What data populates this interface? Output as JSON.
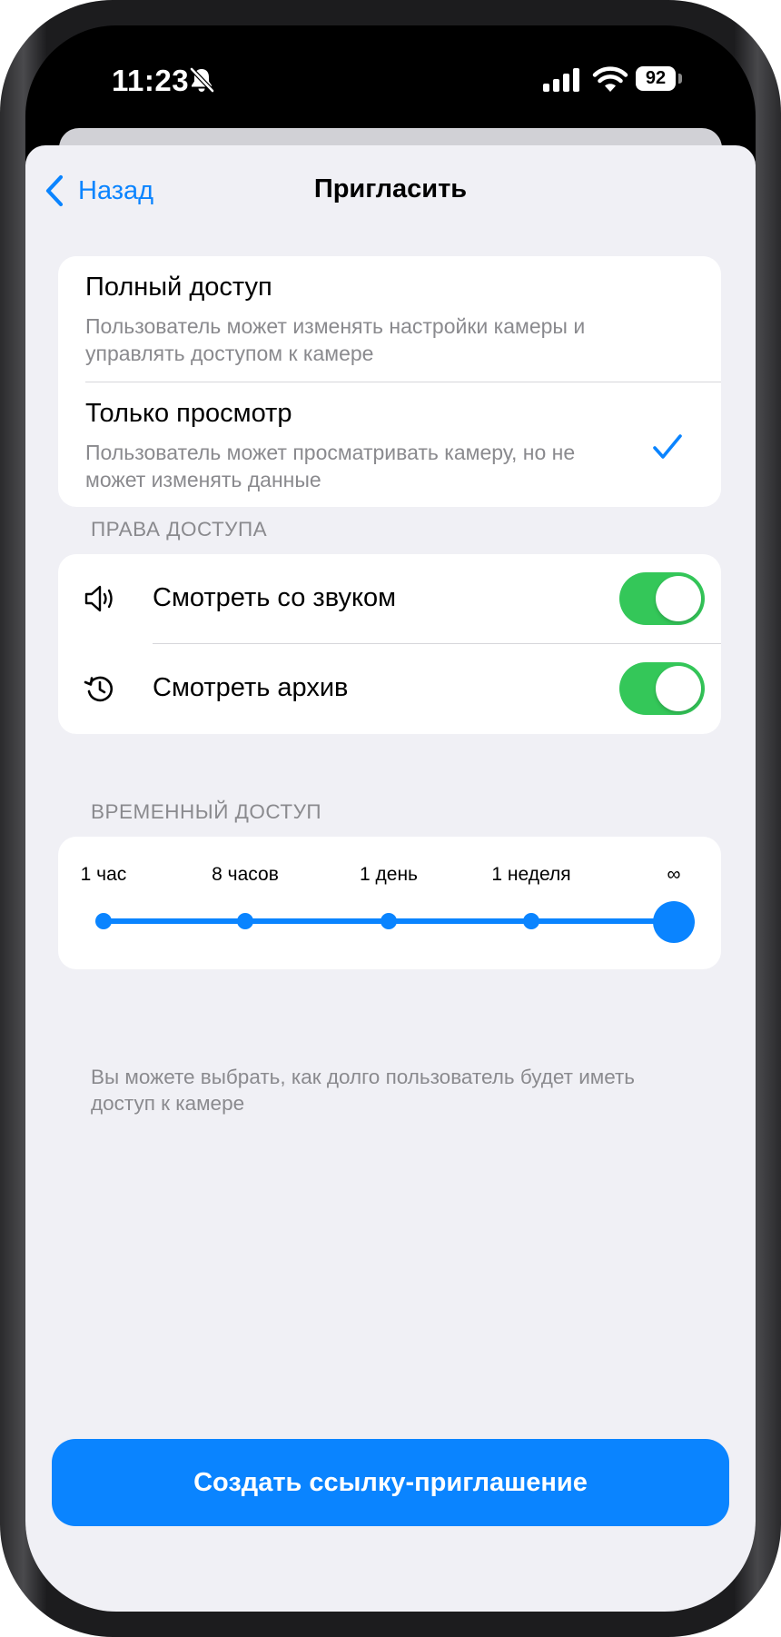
{
  "status_bar": {
    "time": "11:23",
    "battery": "92",
    "icons": [
      "bell-slash-icon",
      "signal-icon",
      "wifi-icon",
      "battery-icon"
    ]
  },
  "nav": {
    "back_label": "Назад",
    "title": "Пригласить"
  },
  "access_levels": [
    {
      "title": "Полный доступ",
      "description": "Пользователь может изменять настройки камеры и управлять доступом к камере",
      "selected": false
    },
    {
      "title": "Только просмотр",
      "description": "Пользователь может просматривать камеру, но не может изменять данные",
      "selected": true
    }
  ],
  "permissions": {
    "header": "ПРАВА ДОСТУПА",
    "items": [
      {
        "label": "Смотреть со звуком",
        "icon": "speaker-icon",
        "enabled": true
      },
      {
        "label": "Смотреть архив",
        "icon": "history-icon",
        "enabled": true
      }
    ]
  },
  "temporary_access": {
    "header": "ВРЕМЕННЫЙ ДОСТУП",
    "options": [
      "1 час",
      "8 часов",
      "1 день",
      "1 неделя",
      "∞"
    ],
    "selected_index": 4,
    "hint": "Вы можете выбрать, как долго пользователь будет иметь доступ к камере"
  },
  "create_button": "Создать ссылку-приглашение",
  "colors": {
    "accent": "#0a84ff",
    "toggle_on": "#34c759",
    "background": "#f0f0f5",
    "secondary_text": "#8a8a8e"
  }
}
